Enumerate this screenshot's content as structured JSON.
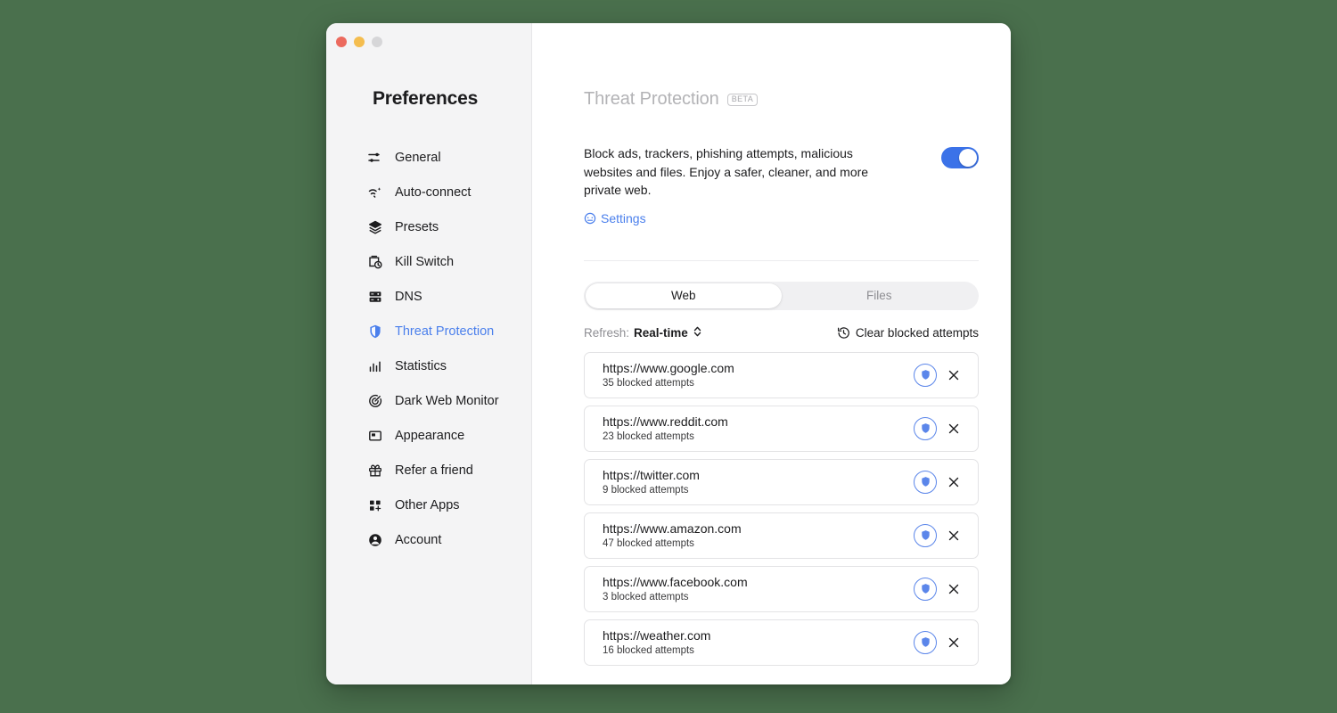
{
  "window": {
    "traffic_lights": [
      {
        "name": "close",
        "color": "#ec6a5e"
      },
      {
        "name": "minimize",
        "color": "#f4bd4f"
      },
      {
        "name": "maximize",
        "color": "#d6d6d8"
      }
    ]
  },
  "sidebar": {
    "title": "Preferences",
    "items": [
      {
        "label": "General",
        "icon": "sliders-icon",
        "active": false
      },
      {
        "label": "Auto-connect",
        "icon": "auto-connect-icon",
        "active": false
      },
      {
        "label": "Presets",
        "icon": "layers-icon",
        "active": false
      },
      {
        "label": "Kill Switch",
        "icon": "kill-switch-icon",
        "active": false
      },
      {
        "label": "DNS",
        "icon": "server-icon",
        "active": false
      },
      {
        "label": "Threat Protection",
        "icon": "shield-icon",
        "active": true
      },
      {
        "label": "Statistics",
        "icon": "bar-chart-icon",
        "active": false
      },
      {
        "label": "Dark Web Monitor",
        "icon": "target-icon",
        "active": false
      },
      {
        "label": "Appearance",
        "icon": "appearance-icon",
        "active": false
      },
      {
        "label": "Refer a friend",
        "icon": "gift-icon",
        "active": false
      },
      {
        "label": "Other Apps",
        "icon": "grid-plus-icon",
        "active": false
      },
      {
        "label": "Account",
        "icon": "user-circle-icon",
        "active": false
      }
    ]
  },
  "main": {
    "title": "Threat Protection",
    "badge": "BETA",
    "description": "Block ads, trackers, phishing attempts, malicious websites and files. Enjoy a safer, cleaner, and more private web.",
    "settings_link": "Settings",
    "toggle_on": true,
    "tabs": [
      {
        "label": "Web",
        "active": true
      },
      {
        "label": "Files",
        "active": false
      }
    ],
    "refresh": {
      "label": "Refresh:",
      "value": "Real-time"
    },
    "clear_button": "Clear blocked attempts",
    "blocked_list": [
      {
        "url": "https://www.google.com",
        "attempts": "35 blocked attempts"
      },
      {
        "url": "https://www.reddit.com",
        "attempts": "23 blocked attempts"
      },
      {
        "url": "https://twitter.com",
        "attempts": "9 blocked attempts"
      },
      {
        "url": "https://www.amazon.com",
        "attempts": "47 blocked attempts"
      },
      {
        "url": "https://www.facebook.com",
        "attempts": "3 blocked attempts"
      },
      {
        "url": "https://weather.com",
        "attempts": "16 blocked attempts"
      }
    ]
  },
  "colors": {
    "accent": "#4a7fec",
    "toggle_on": "#3b72e8",
    "background": "#4a704d",
    "sidebar": "#f4f4f5",
    "title_muted": "#b3b3b6"
  }
}
